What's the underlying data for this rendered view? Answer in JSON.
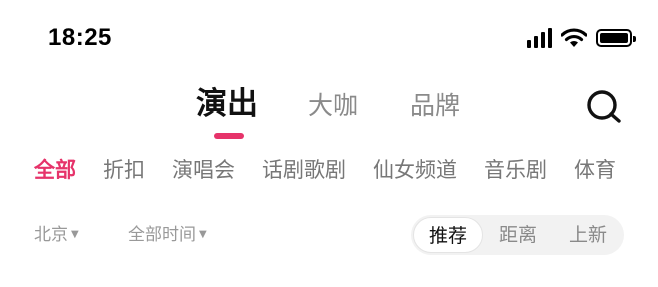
{
  "status_bar": {
    "time": "18:25",
    "icons": [
      "signal-icon",
      "wifi-icon",
      "battery-icon"
    ]
  },
  "header": {
    "tabs": [
      {
        "label": "演出",
        "active": true
      },
      {
        "label": "大咖",
        "active": false
      },
      {
        "label": "品牌",
        "active": false
      }
    ],
    "search_icon": "search-icon",
    "accent_color": "#e6336a"
  },
  "categories": [
    {
      "label": "全部",
      "active": true
    },
    {
      "label": "折扣",
      "active": false
    },
    {
      "label": "演唱会",
      "active": false
    },
    {
      "label": "话剧歌剧",
      "active": false
    },
    {
      "label": "仙女频道",
      "active": false
    },
    {
      "label": "音乐剧",
      "active": false
    },
    {
      "label": "体育",
      "active": false
    }
  ],
  "filters": {
    "city": "北京",
    "time": "全部时间",
    "dropdown_icon": "caret-down-icon"
  },
  "sort": {
    "options": [
      {
        "label": "推荐",
        "active": true
      },
      {
        "label": "距离",
        "active": false
      },
      {
        "label": "上新",
        "active": false
      }
    ]
  }
}
